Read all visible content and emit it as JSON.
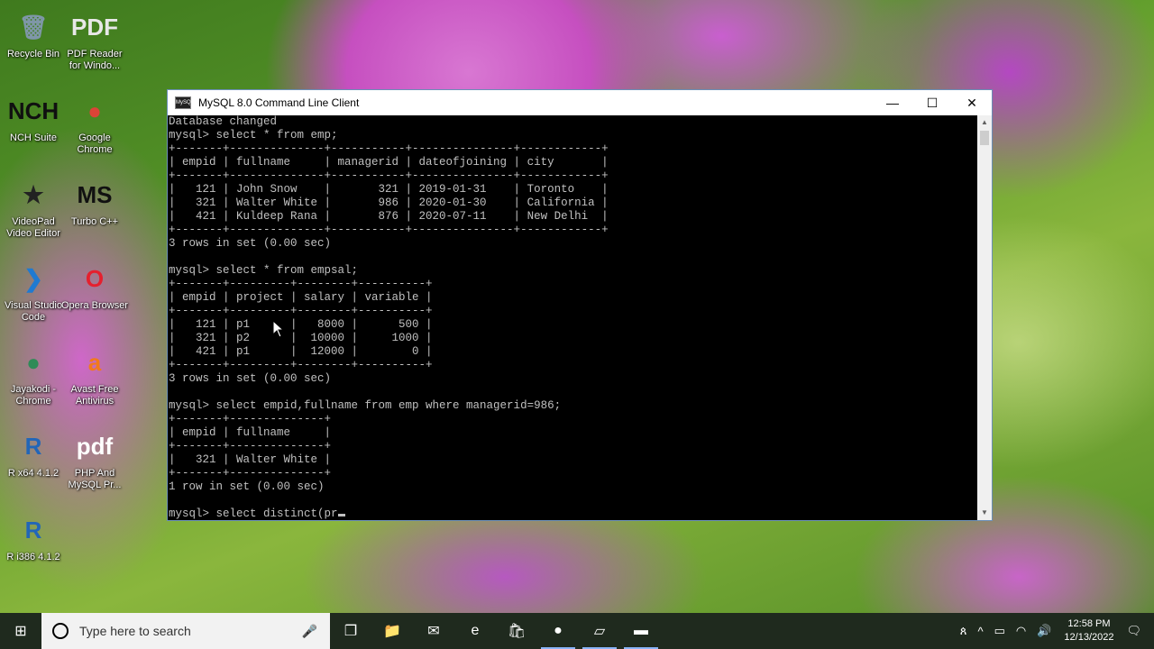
{
  "desktop_icons": [
    {
      "label": "Recycle Bin",
      "glyph": "🗑",
      "color": "#7f97a8"
    },
    {
      "label": "PDF Reader for Windo...",
      "glyph": "PDF",
      "color": "#e8e8e8"
    },
    {
      "label": "NCH Suite",
      "glyph": "NCH",
      "color": "#101010"
    },
    {
      "label": "Google Chrome",
      "glyph": "●",
      "color": "#db4437"
    },
    {
      "label": "VideoPad Video Editor",
      "glyph": "★",
      "color": "#222222"
    },
    {
      "label": "Turbo C++",
      "glyph": "MS",
      "color": "#111111"
    },
    {
      "label": "Visual Studio Code",
      "glyph": "❯",
      "color": "#1f7ad1"
    },
    {
      "label": "Opera Browser",
      "glyph": "O",
      "color": "#e5202e"
    },
    {
      "label": "Jayakodi - Chrome",
      "glyph": "●",
      "color": "#2e8b57"
    },
    {
      "label": "Avast Free Antivirus",
      "glyph": "a",
      "color": "#f27a1a"
    },
    {
      "label": "R x64 4.1.2",
      "glyph": "R",
      "color": "#2266b8"
    },
    {
      "label": "PHP And MySQL Pr...",
      "glyph": "pdf",
      "color": "#ffffff"
    },
    {
      "label": "R i386 4.1.2",
      "glyph": "R",
      "color": "#2266b8"
    }
  ],
  "window": {
    "title": "MySQL 8.0 Command Line Client",
    "app_icon_text": "MySQL",
    "minimize": "—",
    "maximize": "☐",
    "close": "✕"
  },
  "console": {
    "lines": [
      "Database changed",
      "mysql> select * from emp;",
      "+-------+--------------+-----------+---------------+------------+",
      "| empid | fullname     | managerid | dateofjoining | city       |",
      "+-------+--------------+-----------+---------------+------------+",
      "|   121 | John Snow    |       321 | 2019-01-31    | Toronto    |",
      "|   321 | Walter White |       986 | 2020-01-30    | California |",
      "|   421 | Kuldeep Rana |       876 | 2020-07-11    | New Delhi  |",
      "+-------+--------------+-----------+---------------+------------+",
      "3 rows in set (0.00 sec)",
      "",
      "mysql> select * from empsal;",
      "+-------+---------+--------+----------+",
      "| empid | project | salary | variable |",
      "+-------+---------+--------+----------+",
      "|   121 | p1      |   8000 |      500 |",
      "|   321 | p2      |  10000 |     1000 |",
      "|   421 | p1      |  12000 |        0 |",
      "+-------+---------+--------+----------+",
      "3 rows in set (0.00 sec)",
      "",
      "mysql> select empid,fullname from emp where managerid=986;",
      "+-------+--------------+",
      "| empid | fullname     |",
      "+-------+--------------+",
      "|   321 | Walter White |",
      "+-------+--------------+",
      "1 row in set (0.00 sec)",
      ""
    ],
    "current_input": "mysql> select distinct(pr"
  },
  "taskbar": {
    "start_icon": "⊞",
    "search_placeholder": "Type here to search",
    "mic_icon": "🎤",
    "task_view_icon": "❐",
    "apps": [
      {
        "name": "file-explorer",
        "glyph": "📁"
      },
      {
        "name": "mail",
        "glyph": "✉"
      },
      {
        "name": "edge",
        "glyph": "e"
      },
      {
        "name": "store",
        "glyph": "🛍"
      },
      {
        "name": "chrome",
        "glyph": "●"
      },
      {
        "name": "notepad",
        "glyph": "▱"
      },
      {
        "name": "mysql-client",
        "glyph": "▬"
      }
    ],
    "tray": {
      "people": "ጰ",
      "chevron": "^",
      "battery": "▭",
      "network": "◠",
      "volume": "🔊",
      "time": "12:58 PM",
      "date": "12/13/2022",
      "notification": "🗨"
    }
  }
}
